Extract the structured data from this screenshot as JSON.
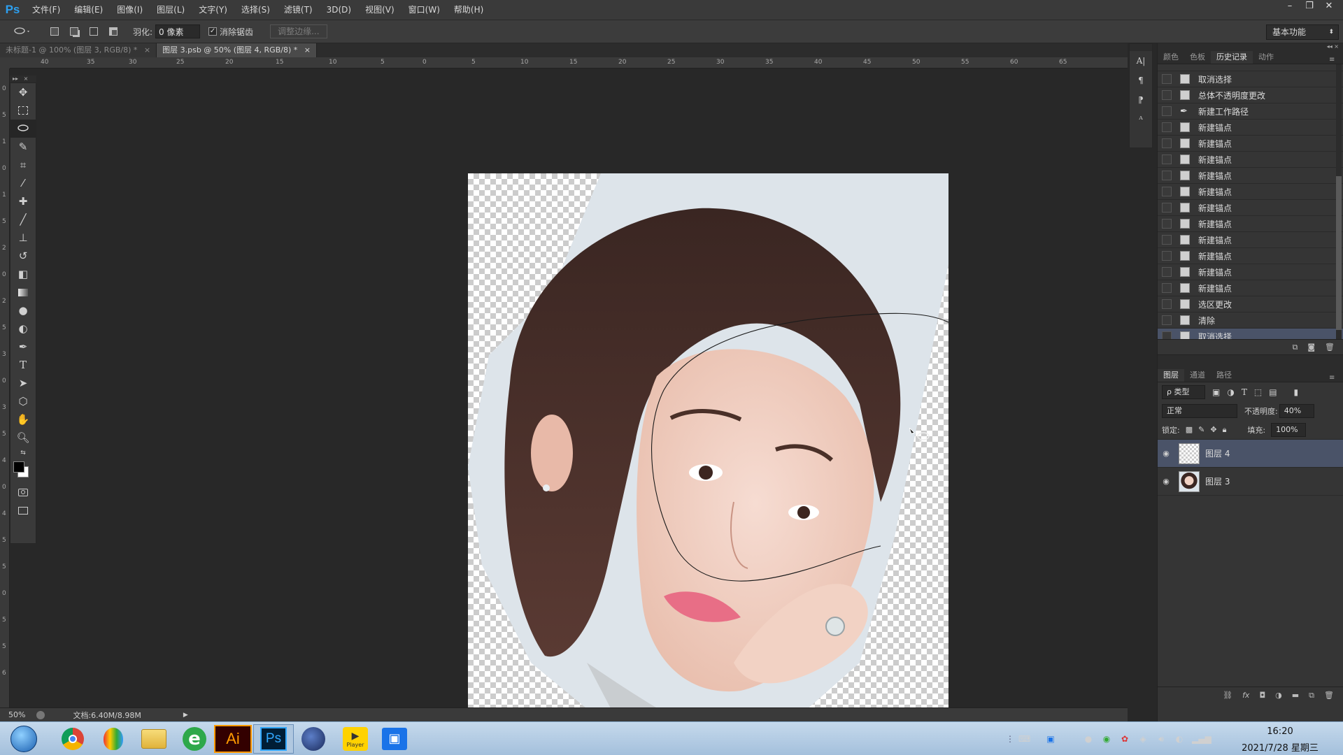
{
  "app": {
    "logo": "Ps",
    "menu": [
      "文件(F)",
      "编辑(E)",
      "图像(I)",
      "图层(L)",
      "文字(Y)",
      "选择(S)",
      "滤镜(T)",
      "3D(D)",
      "视图(V)",
      "窗口(W)",
      "帮助(H)"
    ],
    "window_controls": [
      "–",
      "❐",
      "✕"
    ]
  },
  "options": {
    "feather_label": "羽化:",
    "feather_value": "0 像素",
    "antialias_label": "消除锯齿",
    "refine_label": "调整边缘...",
    "workspace": "基本功能"
  },
  "doc_tabs": [
    {
      "label": "未标题-1 @ 100% (图层 3, RGB/8) *",
      "close": "×"
    },
    {
      "label": "图层 3.psb @ 50% (图层 4, RGB/8) *",
      "close": "×"
    }
  ],
  "ruler": {
    "h_labels": [
      "40",
      "35",
      "30",
      "25",
      "20",
      "15",
      "10",
      "5",
      "0",
      "5",
      "10",
      "15",
      "20",
      "25",
      "30",
      "35",
      "40",
      "45",
      "50",
      "55",
      "60",
      "65"
    ],
    "v_labels": [
      "0",
      "5",
      "1",
      "0",
      "1",
      "5",
      "2",
      "0",
      "2",
      "5",
      "3",
      "0",
      "3",
      "5",
      "4",
      "0",
      "4",
      "5",
      "5",
      "0",
      "5",
      "5",
      "6"
    ]
  },
  "status": {
    "zoom": "50%",
    "doc_size": "文档:6.40M/8.98M",
    "arrow": "▶"
  },
  "history": {
    "tabs": [
      "颜色",
      "色板",
      "历史记录",
      "动作"
    ],
    "active_tab": 2,
    "items": [
      "取消选择",
      "总体不透明度更改",
      "新建工作路径",
      "新建锚点",
      "新建锚点",
      "新建锚点",
      "新建锚点",
      "新建锚点",
      "新建锚点",
      "新建锚点",
      "新建锚点",
      "新建锚点",
      "新建锚点",
      "新建锚点",
      "选区更改",
      "清除",
      "取消选择"
    ],
    "selected_index": 16
  },
  "layers": {
    "tabs": [
      "图层",
      "通道",
      "路径"
    ],
    "active_tab": 0,
    "kind_filter": "ρ 类型",
    "blend_mode": "正常",
    "opacity_label": "不透明度:",
    "opacity_value": "40%",
    "lock_label": "锁定:",
    "fill_label": "填充:",
    "fill_value": "100%",
    "items": [
      {
        "name": "图层 4",
        "selected": true
      },
      {
        "name": "图层 3",
        "selected": false
      }
    ]
  },
  "taskbar": {
    "time": "16:20",
    "date": "2021/7/28 星期三",
    "apps": [
      "start-orb",
      "chrome",
      "balloon",
      "folder",
      "ie",
      "Ai",
      "Ps",
      "c4d",
      "Player",
      "video"
    ]
  },
  "colors": {
    "ps_blue": "#2da0f0",
    "selected_row": "#4a5368",
    "ai_orange": "#ff9a00",
    "ai_bg": "#330000",
    "ps_bg": "#001e36"
  }
}
